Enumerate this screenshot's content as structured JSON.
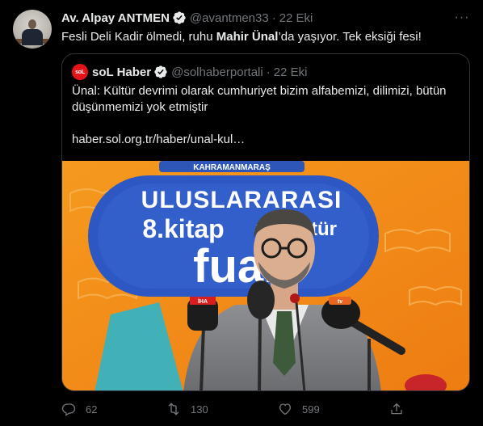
{
  "tweet": {
    "author_name": "Av. Alpay ANTMEN",
    "handle": "@avantmen33",
    "separator": "·",
    "date": "22 Eki",
    "text_before": "Fesli Deli Kadir ölmedi, ruhu ",
    "text_bold": "Mahir Ünal",
    "text_after": "’da yaşıyor. Tek eksiği fesi!",
    "more_label": "···"
  },
  "quote": {
    "avatar_text": "soL",
    "author_name": "soL Haber",
    "handle": "@solhaberportali",
    "separator": "·",
    "date": "22 Eki",
    "text": "Ünal: Kültür devrimi olarak cumhuriyet bizim alfabemizi, dilimizi, bütün düşünmemizi yok etmiştir",
    "link": "haber.sol.org.tr/haber/unal-kul…",
    "photo": {
      "banner_top": "KAHRAMANMARAŞ",
      "banner_line1": "ULUSLARARASI",
      "banner_line2": "8.kitap",
      "banner_line2b": "ve kültür",
      "banner_line3": "fuarı",
      "mic_label_1": "İHA",
      "mic_label_2": "tv"
    }
  },
  "actions": {
    "reply_count": "62",
    "retweet_count": "130",
    "like_count": "599"
  },
  "colors": {
    "background": "#000000",
    "text": "#e7e9ea",
    "muted": "#71767b",
    "verified": "#1d9bf0",
    "border": "#2f3336",
    "sol_red": "#e3151b"
  }
}
